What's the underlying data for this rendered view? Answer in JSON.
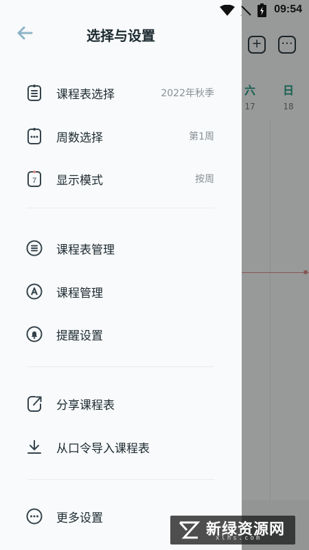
{
  "status_bar": {
    "time": "09:54"
  },
  "background": {
    "days": [
      {
        "name": "六",
        "date": "17"
      },
      {
        "name": "日",
        "date": "18"
      }
    ]
  },
  "drawer": {
    "title": "选择与设置",
    "section1": [
      {
        "label": "课程表选择",
        "value": "2022年秋季",
        "icon": "schedule-list-icon"
      },
      {
        "label": "周数选择",
        "value": "第1周",
        "icon": "week-dots-icon"
      },
      {
        "label": "显示模式",
        "value": "按周",
        "icon": "calendar-7-icon"
      }
    ],
    "section2": [
      {
        "label": "课程表管理",
        "icon": "list-icon"
      },
      {
        "label": "课程管理",
        "icon": "course-a-icon"
      },
      {
        "label": "提醒设置",
        "icon": "bell-icon"
      }
    ],
    "section3": [
      {
        "label": "分享课程表",
        "icon": "share-icon"
      },
      {
        "label": "从口令导入课程表",
        "icon": "download-icon"
      }
    ],
    "section4": [
      {
        "label": "更多设置",
        "icon": "more-icon"
      }
    ],
    "calendar_icon_number": "7"
  },
  "watermark": {
    "text": "新绿资源网",
    "sub": "xlhs.com"
  }
}
